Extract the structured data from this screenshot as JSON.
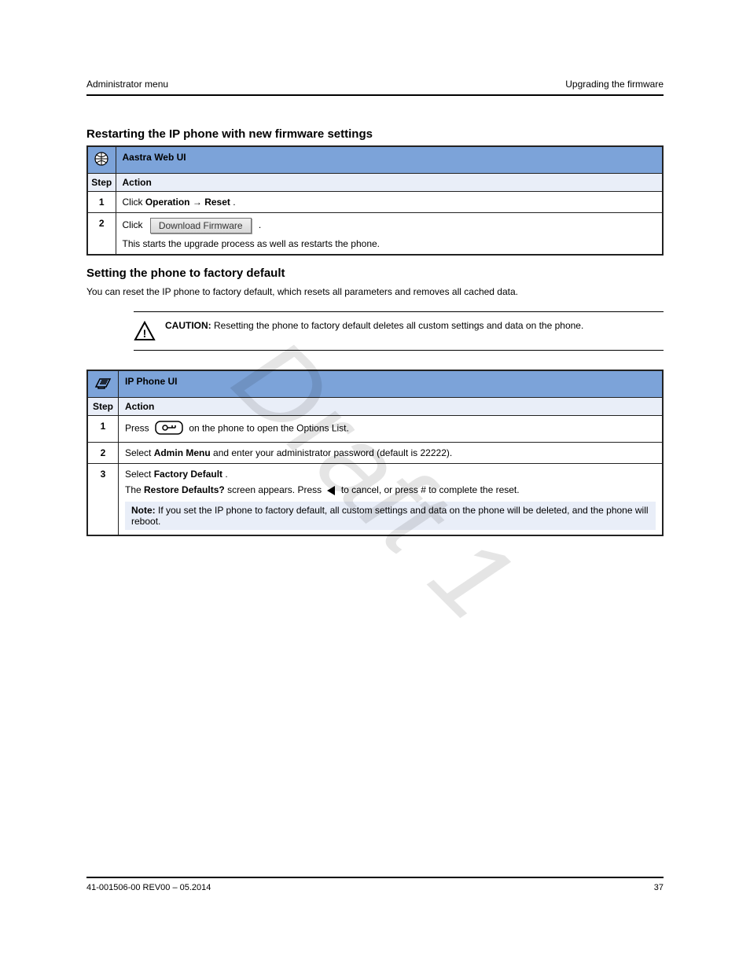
{
  "watermark": "Draft 1",
  "header": {
    "left": "Administrator menu",
    "right": "Upgrading the firmware"
  },
  "columns": {
    "step": "Step",
    "action": "Action"
  },
  "web_table": {
    "title": "Restarting the IP phone with new firmware settings",
    "heading": "Aastra Web UI",
    "rows": [
      {
        "step": "1",
        "pre": "Click ",
        "bold1": "Operation",
        "mid": " → ",
        "bold2": "Reset",
        "post": "."
      },
      {
        "step": "2",
        "pre": "Click ",
        "button": "Download Firmware",
        "post": ".",
        "line2": "This starts the upgrade process as well as restarts the phone."
      }
    ]
  },
  "phone_section": {
    "title": "Setting the phone to factory default",
    "desc": "You can reset the IP phone to factory default, which resets all parameters and removes all cached data."
  },
  "caution": {
    "label": "CAUTION:  ",
    "body": "Resetting the phone to factory default deletes all custom settings and data on the phone."
  },
  "phone_table": {
    "heading": "IP Phone UI",
    "rows": [
      {
        "step": "1",
        "pre": "Press ",
        "post": " on the phone to open the Options List."
      },
      {
        "step": "2",
        "pre": "Select ",
        "bold": "Admin Menu",
        "post": " and enter your administrator password (default is 22222)."
      },
      {
        "step": "3",
        "line1_pre": "Select ",
        "line1_bold": "Factory Default",
        "line1_post": ".",
        "line2_pre": "The ",
        "line2_bold": "Restore Defaults?",
        "line2_mid": " screen appears. Press ",
        "line2_post": " to cancel, or press # to complete the reset.",
        "note_label": "Note: ",
        "note_body": "If you set the IP phone to factory default, all custom settings and data on the phone will be deleted, and the phone will reboot."
      }
    ]
  },
  "footer": {
    "left": "41-001506-00 REV00 – 05.2014",
    "right": "37"
  }
}
